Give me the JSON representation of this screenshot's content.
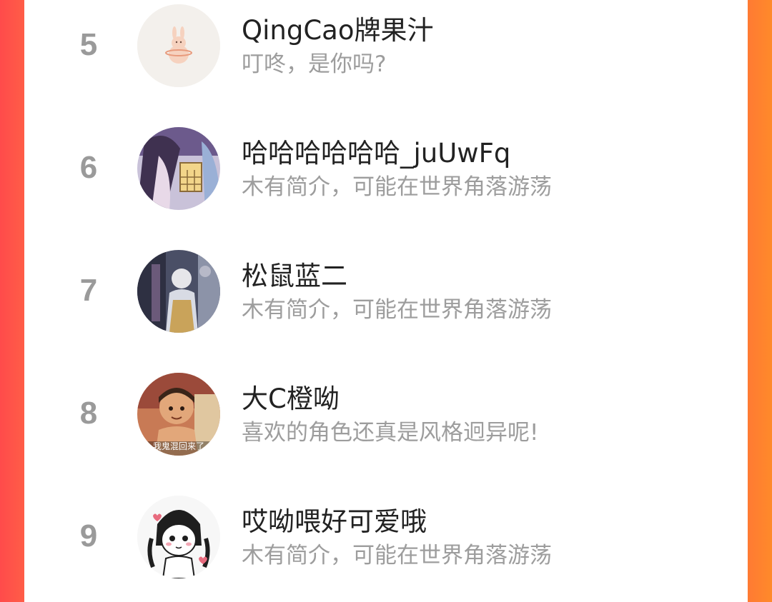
{
  "ranking_list": [
    {
      "rank": "5",
      "name": "QingCao牌果汁",
      "bio": "叮咚，是你吗?",
      "avatar_icon": "rabbit-avatar-icon"
    },
    {
      "rank": "6",
      "name": "哈哈哈哈哈哈_juUwFq",
      "bio": "木有简介，可能在世界角落游荡",
      "avatar_icon": "anime-girl-avatar-icon"
    },
    {
      "rank": "7",
      "name": "松鼠蓝二",
      "bio": "木有简介，可能在世界角落游荡",
      "avatar_icon": "anime-scene-avatar-icon"
    },
    {
      "rank": "8",
      "name": "大C橙呦",
      "bio": "喜欢的角色还真是风格迥异呢!",
      "avatar_icon": "cartoon-kid-avatar-icon",
      "avatar_caption": "我鬼混回来了"
    },
    {
      "rank": "9",
      "name": "哎呦喂好可爱哦",
      "bio": "木有简介，可能在世界角落游荡",
      "avatar_icon": "sketch-girl-avatar-icon"
    }
  ],
  "colors": {
    "left_edge": "#ff4b4b",
    "right_edge": "#ff8a2a",
    "rank_text": "#9a9a9a",
    "name_text": "#222222",
    "bio_text": "#9d9d9d"
  }
}
